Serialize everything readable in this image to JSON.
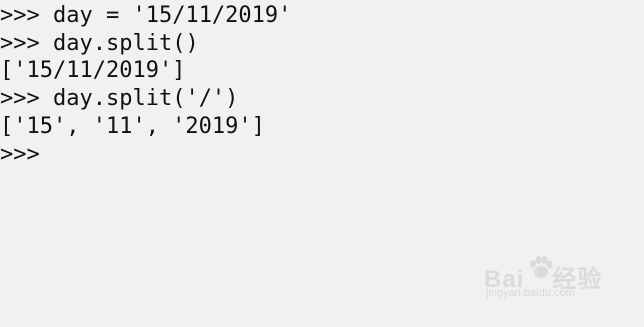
{
  "console": {
    "lines": [
      {
        "prompt": ">>>",
        "text": " day = '15/11/2019'"
      },
      {
        "prompt": ">>>",
        "text": " day.split()"
      },
      {
        "output": "['15/11/2019']"
      },
      {
        "prompt": ">>>",
        "text": " day.split('/')"
      },
      {
        "output": "['15', '11', '2019']"
      },
      {
        "prompt": ">>>",
        "text": ""
      }
    ]
  },
  "watermark": {
    "brand": "Bai",
    "brand_suffix": "经验",
    "url": "jingyan.baidu.com",
    "icon": "paw-icon"
  },
  "colors": {
    "background": "#f1f1f1",
    "text": "#111111",
    "watermark": "#d9d9d9"
  }
}
